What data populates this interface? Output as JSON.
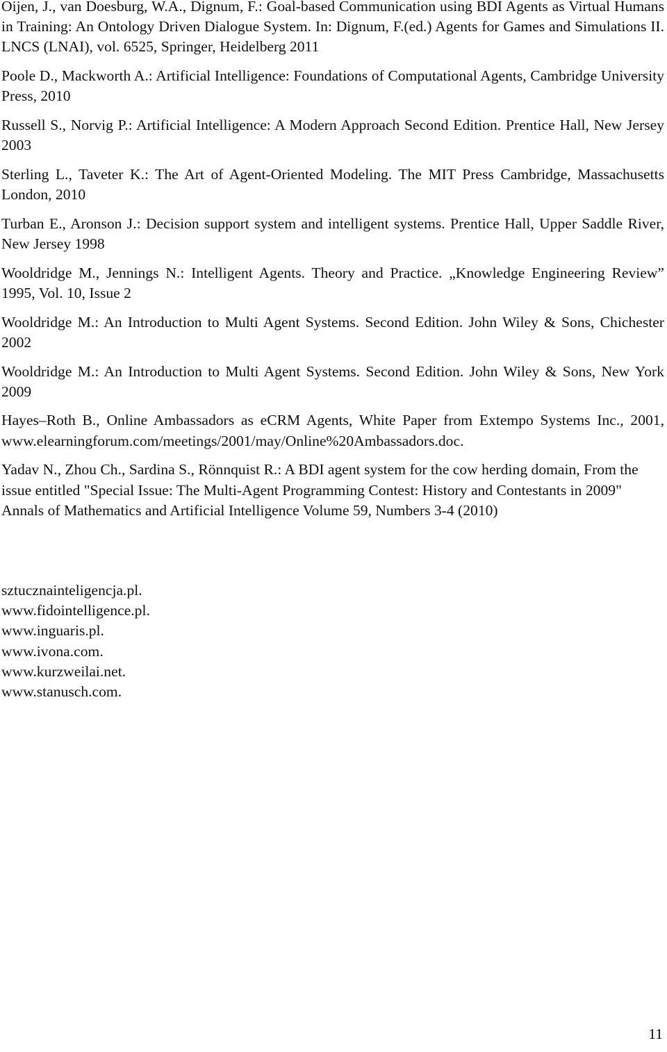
{
  "references": [
    {
      "text": "Oijen, J., van Doesburg, W.A., Dignum, F.: Goal-based Communication using BDI Agents as Virtual Humans in Training: An Ontology Driven Dialogue System. In: Dignum, F.(ed.) Agents for Games and Simulations II. LNCS (LNAI), vol. 6525, Springer, Heidelberg 2011"
    },
    {
      "text": "Poole D., Mackworth A.: Artificial Intelligence: Foundations of Computational Agents, Cambridge University Press, 2010"
    },
    {
      "text": "Russell S., Norvig P.: Artificial Intelligence: A Modern Approach Second Edition. Prentice Hall, New Jersey 2003"
    },
    {
      "text": "Sterling L., Taveter K.: The Art of Agent-Oriented Modeling. The MIT Press Cambridge, Massachusetts London, 2010"
    },
    {
      "text": "Turban E., Aronson J.: Decision support system and intelligent systems. Prentice Hall, Upper Saddle River, New Jersey 1998"
    },
    {
      "text": "Wooldridge M., Jennings N.: Intelligent Agents. Theory and Practice. „Knowledge Engineering Review” 1995, Vol. 10, Issue 2"
    },
    {
      "text": "Wooldridge M.: An Introduction to Multi Agent Systems. Second Edition. John Wiley & Sons, Chichester 2002"
    },
    {
      "text": "Wooldridge M.: An Introduction to Multi Agent Systems. Second Edition. John Wiley & Sons, New York 2009"
    },
    {
      "text": "Hayes–Roth B., Online Ambassadors as eCRM Agents, White Paper from Extempo Systems Inc., 2001, www.elearningforum.com/meetings/2001/may/Online%20Ambassadors.doc."
    },
    {
      "text": "Yadav N., Zhou Ch., Sardina S., Rönnquist R.: A BDI agent system for the cow herding domain, From the issue entitled \"Special Issue: The Multi-Agent Programming Contest: History and Contestants in 2009\" Annals of Mathematics and Artificial Intelligence Volume 59, Numbers 3-4 (2010)"
    }
  ],
  "web_links": [
    "sztucznainteligencja.pl.",
    "www.fidointelligence.pl.",
    "www.inguaris.pl.",
    "www.ivona.com.",
    "www.kurzweilai.net.",
    "www.stanusch.com."
  ],
  "page_number": "11"
}
